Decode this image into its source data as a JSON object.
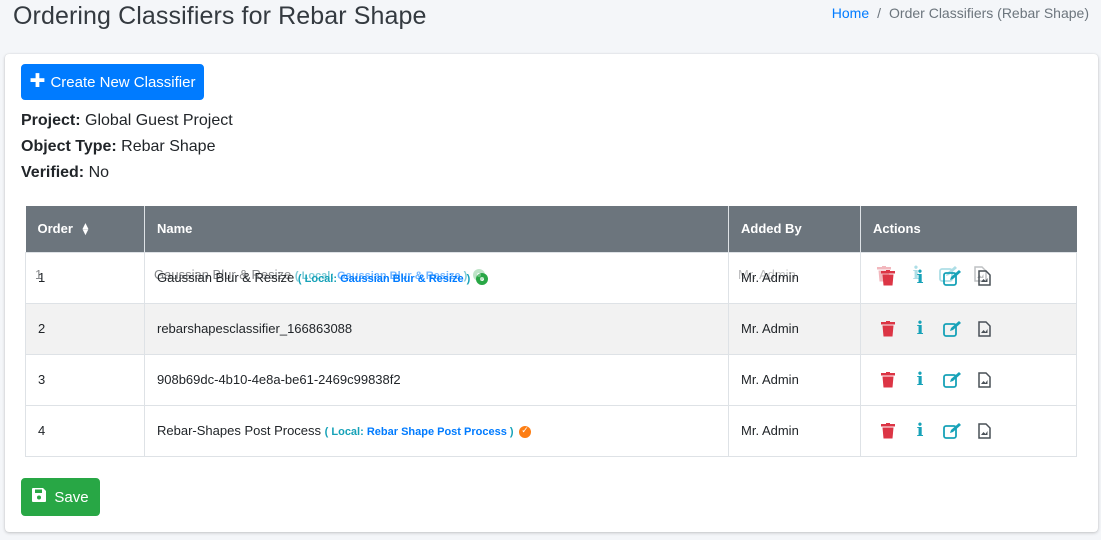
{
  "header": {
    "title": "Ordering Classifiers for Rebar Shape",
    "breadcrumb": {
      "home": "Home",
      "separator": "/",
      "current": "Order Classifiers (Rebar Shape)"
    }
  },
  "toolbar": {
    "create_label": "Create New Classifier",
    "save_label": "Save"
  },
  "details": {
    "project_label": "Project:",
    "project_value": "Global Guest Project",
    "object_type_label": "Object Type:",
    "object_type_value": "Rebar Shape",
    "verified_label": "Verified:",
    "verified_value": "No"
  },
  "table": {
    "headers": {
      "order": "Order",
      "name": "Name",
      "added_by": "Added By",
      "actions": "Actions"
    },
    "rows": [
      {
        "order": "1",
        "name": "Gaussian Blur & Resize",
        "local_prefix": "( Local: ",
        "local_name": "Gaussian Blur & Resize",
        "local_suffix": " )",
        "status": "green",
        "added_by": "Mr. Admin"
      },
      {
        "order": "2",
        "name": "rebarshapesclassifier_166863088",
        "added_by": "Mr. Admin"
      },
      {
        "order": "3",
        "name": "908b69dc-4b10-4e8a-be61-2469c99838f2",
        "added_by": "Mr. Admin"
      },
      {
        "order": "4",
        "name": "Rebar-Shapes Post Process",
        "local_prefix": "( Local: ",
        "local_name": "Rebar Shape Post Process",
        "local_suffix": " )",
        "status": "orange",
        "added_by": "Mr. Admin"
      }
    ]
  },
  "icons": {
    "create": "plus-icon",
    "sort": "sort-icon",
    "delete": "trash-icon",
    "info": "info-icon",
    "edit": "edit-icon",
    "report": "report-icon",
    "save": "save-icon"
  },
  "colors": {
    "primary": "#007bff",
    "success": "#28a745",
    "danger": "#dc3545",
    "info": "#17a2b8",
    "warning": "#fd7e14",
    "header": "#6c757d"
  }
}
